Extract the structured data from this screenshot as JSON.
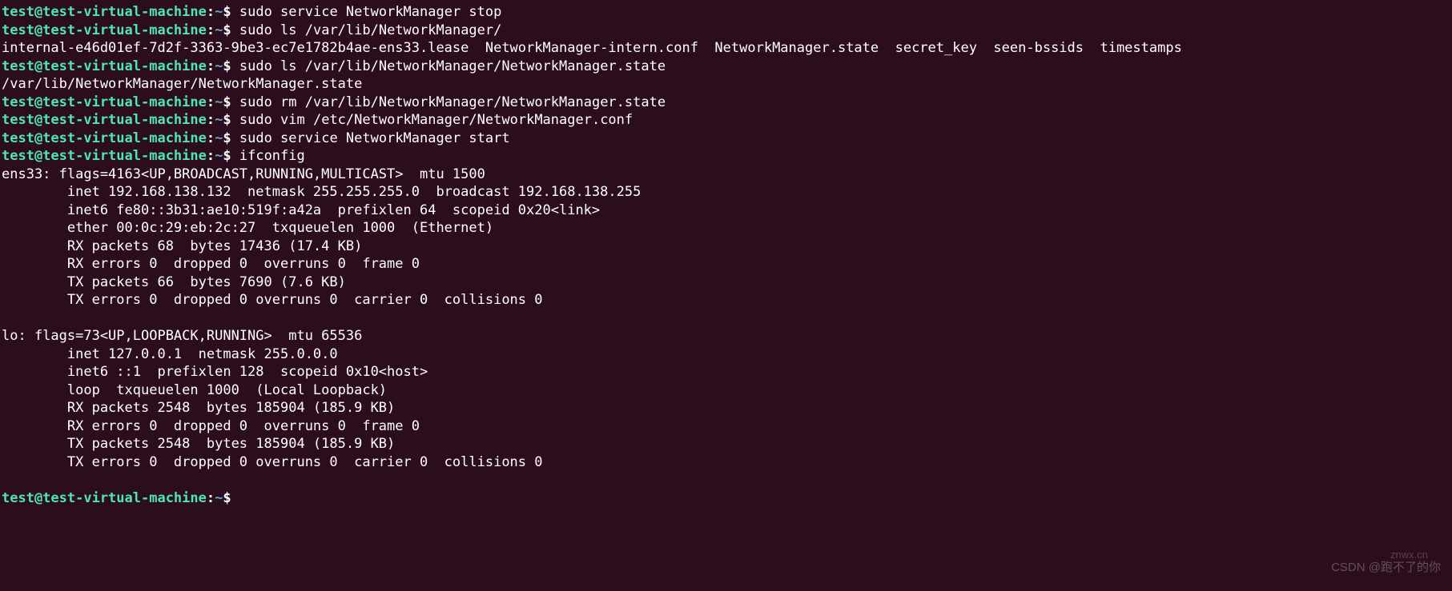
{
  "prompt": {
    "userhost": "test@test-virtual-machine",
    "colon": ":",
    "path": "~",
    "dollar": "$"
  },
  "lines": [
    {
      "type": "prompt",
      "cmd": " sudo service NetworkManager stop"
    },
    {
      "type": "prompt",
      "cmd": " sudo ls /var/lib/NetworkManager/"
    },
    {
      "type": "output",
      "text": "internal-e46d01ef-7d2f-3363-9be3-ec7e1782b4ae-ens33.lease  NetworkManager-intern.conf  NetworkManager.state  secret_key  seen-bssids  timestamps"
    },
    {
      "type": "prompt",
      "cmd": " sudo ls /var/lib/NetworkManager/NetworkManager.state"
    },
    {
      "type": "output",
      "text": "/var/lib/NetworkManager/NetworkManager.state"
    },
    {
      "type": "prompt",
      "cmd": " sudo rm /var/lib/NetworkManager/NetworkManager.state"
    },
    {
      "type": "prompt",
      "cmd": " sudo vim /etc/NetworkManager/NetworkManager.conf"
    },
    {
      "type": "prompt",
      "cmd": " sudo service NetworkManager start"
    },
    {
      "type": "prompt",
      "cmd": " ifconfig"
    },
    {
      "type": "output",
      "text": "ens33: flags=4163<UP,BROADCAST,RUNNING,MULTICAST>  mtu 1500"
    },
    {
      "type": "output",
      "text": "        inet 192.168.138.132  netmask 255.255.255.0  broadcast 192.168.138.255"
    },
    {
      "type": "output",
      "text": "        inet6 fe80::3b31:ae10:519f:a42a  prefixlen 64  scopeid 0x20<link>"
    },
    {
      "type": "output",
      "text": "        ether 00:0c:29:eb:2c:27  txqueuelen 1000  (Ethernet)"
    },
    {
      "type": "output",
      "text": "        RX packets 68  bytes 17436 (17.4 KB)"
    },
    {
      "type": "output",
      "text": "        RX errors 0  dropped 0  overruns 0  frame 0"
    },
    {
      "type": "output",
      "text": "        TX packets 66  bytes 7690 (7.6 KB)"
    },
    {
      "type": "output",
      "text": "        TX errors 0  dropped 0 overruns 0  carrier 0  collisions 0"
    },
    {
      "type": "output",
      "text": ""
    },
    {
      "type": "output",
      "text": "lo: flags=73<UP,LOOPBACK,RUNNING>  mtu 65536"
    },
    {
      "type": "output",
      "text": "        inet 127.0.0.1  netmask 255.0.0.0"
    },
    {
      "type": "output",
      "text": "        inet6 ::1  prefixlen 128  scopeid 0x10<host>"
    },
    {
      "type": "output",
      "text": "        loop  txqueuelen 1000  (Local Loopback)"
    },
    {
      "type": "output",
      "text": "        RX packets 2548  bytes 185904 (185.9 KB)"
    },
    {
      "type": "output",
      "text": "        RX errors 0  dropped 0  overruns 0  frame 0"
    },
    {
      "type": "output",
      "text": "        TX packets 2548  bytes 185904 (185.9 KB)"
    },
    {
      "type": "output",
      "text": "        TX errors 0  dropped 0 overruns 0  carrier 0  collisions 0"
    },
    {
      "type": "output",
      "text": ""
    },
    {
      "type": "prompt",
      "cmd": " "
    }
  ],
  "watermark1": "CSDN @跑不了的你",
  "watermark2": "znwx.cn"
}
